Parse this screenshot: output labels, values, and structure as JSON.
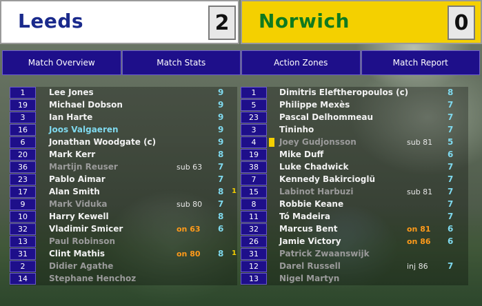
{
  "home": {
    "name": "Leeds",
    "score": "2",
    "players": [
      {
        "num": "1",
        "name": "Lee Jones",
        "status": "",
        "sub": "",
        "sub_type": "",
        "rating": "9",
        "goals": ""
      },
      {
        "num": "19",
        "name": "Michael Dobson",
        "status": "",
        "sub": "",
        "sub_type": "",
        "rating": "9",
        "goals": ""
      },
      {
        "num": "3",
        "name": "Ian Harte",
        "status": "",
        "sub": "",
        "sub_type": "",
        "rating": "9",
        "goals": ""
      },
      {
        "num": "16",
        "name": "Joos Valgaeren",
        "status": "hl",
        "sub": "",
        "sub_type": "",
        "rating": "9",
        "goals": ""
      },
      {
        "num": "6",
        "name": "Jonathan Woodgate (c)",
        "status": "",
        "sub": "",
        "sub_type": "",
        "rating": "9",
        "goals": ""
      },
      {
        "num": "20",
        "name": "Mark Kerr",
        "status": "",
        "sub": "",
        "sub_type": "",
        "rating": "8",
        "goals": ""
      },
      {
        "num": "36",
        "name": "Martijn Reuser",
        "status": "off",
        "sub": "sub 63",
        "sub_type": "off",
        "rating": "7",
        "goals": ""
      },
      {
        "num": "23",
        "name": "Pablo Aimar",
        "status": "",
        "sub": "",
        "sub_type": "",
        "rating": "7",
        "goals": ""
      },
      {
        "num": "17",
        "name": "Alan Smith",
        "status": "",
        "sub": "",
        "sub_type": "",
        "rating": "8",
        "goals": "1"
      },
      {
        "num": "9",
        "name": "Mark Viduka",
        "status": "off",
        "sub": "sub 80",
        "sub_type": "off",
        "rating": "7",
        "goals": ""
      },
      {
        "num": "10",
        "name": "Harry Kewell",
        "status": "",
        "sub": "",
        "sub_type": "",
        "rating": "8",
        "goals": ""
      },
      {
        "num": "32",
        "name": "Vladimir Smicer",
        "status": "",
        "sub": "on 63",
        "sub_type": "on",
        "rating": "6",
        "goals": ""
      },
      {
        "num": "13",
        "name": "Paul Robinson",
        "status": "off",
        "sub": "",
        "sub_type": "",
        "rating": "",
        "goals": ""
      },
      {
        "num": "31",
        "name": "Clint Mathis",
        "status": "",
        "sub": "on 80",
        "sub_type": "on",
        "rating": "8",
        "goals": "1"
      },
      {
        "num": "2",
        "name": "Didier Agathe",
        "status": "off",
        "sub": "",
        "sub_type": "",
        "rating": "",
        "goals": ""
      },
      {
        "num": "14",
        "name": "Stephane Henchoz",
        "status": "off",
        "sub": "",
        "sub_type": "",
        "rating": "",
        "goals": ""
      }
    ]
  },
  "away": {
    "name": "Norwich",
    "score": "0",
    "players": [
      {
        "num": "1",
        "name": "Dimitris Eleftheropoulos (c)",
        "status": "",
        "sub": "",
        "sub_type": "",
        "rating": "8",
        "card": false
      },
      {
        "num": "5",
        "name": "Philippe Mexès",
        "status": "",
        "sub": "",
        "sub_type": "",
        "rating": "7",
        "card": false
      },
      {
        "num": "23",
        "name": "Pascal Delhommeau",
        "status": "",
        "sub": "",
        "sub_type": "",
        "rating": "7",
        "card": false
      },
      {
        "num": "3",
        "name": "Tininho",
        "status": "",
        "sub": "",
        "sub_type": "",
        "rating": "7",
        "card": false
      },
      {
        "num": "4",
        "name": "Joey Gudjonsson",
        "status": "off",
        "sub": "sub 81",
        "sub_type": "off",
        "rating": "5",
        "card": true
      },
      {
        "num": "19",
        "name": "Mike Duff",
        "status": "",
        "sub": "",
        "sub_type": "",
        "rating": "6",
        "card": false
      },
      {
        "num": "38",
        "name": "Luke Chadwick",
        "status": "",
        "sub": "",
        "sub_type": "",
        "rating": "7",
        "card": false
      },
      {
        "num": "7",
        "name": "Kennedy Bakircioglü",
        "status": "",
        "sub": "",
        "sub_type": "",
        "rating": "7",
        "card": false
      },
      {
        "num": "15",
        "name": "Labinot Harbuzi",
        "status": "off",
        "sub": "sub 81",
        "sub_type": "off",
        "rating": "7",
        "card": false
      },
      {
        "num": "8",
        "name": "Robbie Keane",
        "status": "",
        "sub": "",
        "sub_type": "",
        "rating": "7",
        "card": false
      },
      {
        "num": "11",
        "name": "Tó Madeira",
        "status": "",
        "sub": "",
        "sub_type": "",
        "rating": "7",
        "card": false
      },
      {
        "num": "32",
        "name": "Marcus Bent",
        "status": "",
        "sub": "on 81",
        "sub_type": "on",
        "rating": "6",
        "card": false
      },
      {
        "num": "26",
        "name": "Jamie Victory",
        "status": "",
        "sub": "on 86",
        "sub_type": "on",
        "rating": "6",
        "card": false
      },
      {
        "num": "31",
        "name": "Patrick Zwaanswijk",
        "status": "off",
        "sub": "",
        "sub_type": "",
        "rating": "",
        "card": false
      },
      {
        "num": "12",
        "name": "Darel Russell",
        "status": "off",
        "sub": "inj 86",
        "sub_type": "off",
        "rating": "7",
        "card": false
      },
      {
        "num": "13",
        "name": "Nigel Martyn",
        "status": "off",
        "sub": "",
        "sub_type": "",
        "rating": "",
        "card": false
      }
    ]
  },
  "tabs": [
    "Match Overview",
    "Match Stats",
    "Action Zones",
    "Match Report"
  ],
  "colors": {
    "home_bg": "#ffffff",
    "home_text": "#1a2a8c",
    "away_bg": "#f4d000",
    "away_text": "#0f7a1e",
    "tab_bg": "#1e0f8a",
    "rating": "#7fd9ee",
    "sub_on": "#ff9a1a",
    "card": "#f4d000"
  }
}
